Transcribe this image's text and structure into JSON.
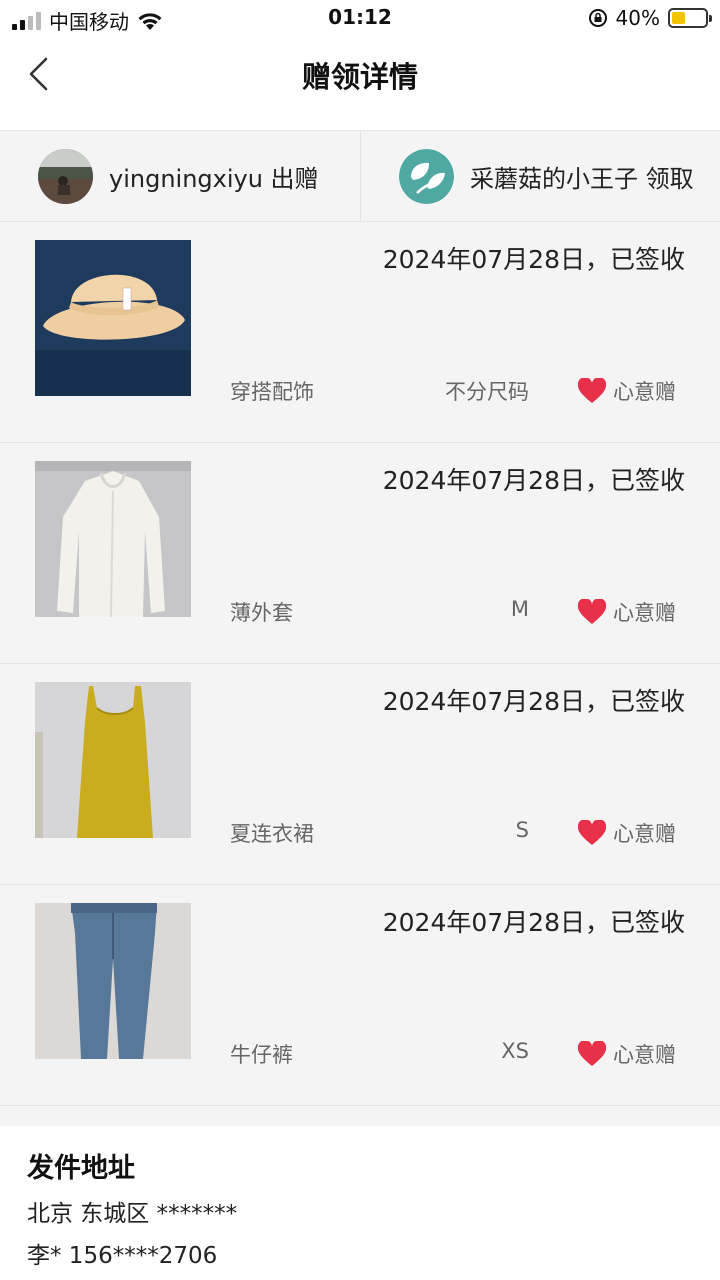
{
  "status_bar": {
    "carrier": "中国移动",
    "time": "01:12",
    "battery_percent": "40%",
    "battery_level": 0.4
  },
  "header": {
    "title": "赠领详情"
  },
  "parties": {
    "giver": {
      "name": "yingningxiyu 出赠"
    },
    "receiver": {
      "name": "采蘑菇的小王子 领取"
    }
  },
  "items": [
    {
      "status": "2024年07月28日，已签收",
      "category": "穿搭配饰",
      "size": "不分尺码",
      "tag": "心意赠",
      "thumb": "bucket-hat"
    },
    {
      "status": "2024年07月28日，已签收",
      "category": "薄外套",
      "size": "M",
      "tag": "心意赠",
      "thumb": "white-jacket"
    },
    {
      "status": "2024年07月28日，已签收",
      "category": "夏连衣裙",
      "size": "S",
      "tag": "心意赠",
      "thumb": "yellow-dress"
    },
    {
      "status": "2024年07月28日，已签收",
      "category": "牛仔裤",
      "size": "XS",
      "tag": "心意赠",
      "thumb": "jeans"
    }
  ],
  "address": {
    "title": "发件地址",
    "line": "北京 东城区 *******",
    "contact": "李* 156****2706"
  },
  "colors": {
    "heart": "#e8304a",
    "receiver_avatar": "#4fa9a2"
  }
}
